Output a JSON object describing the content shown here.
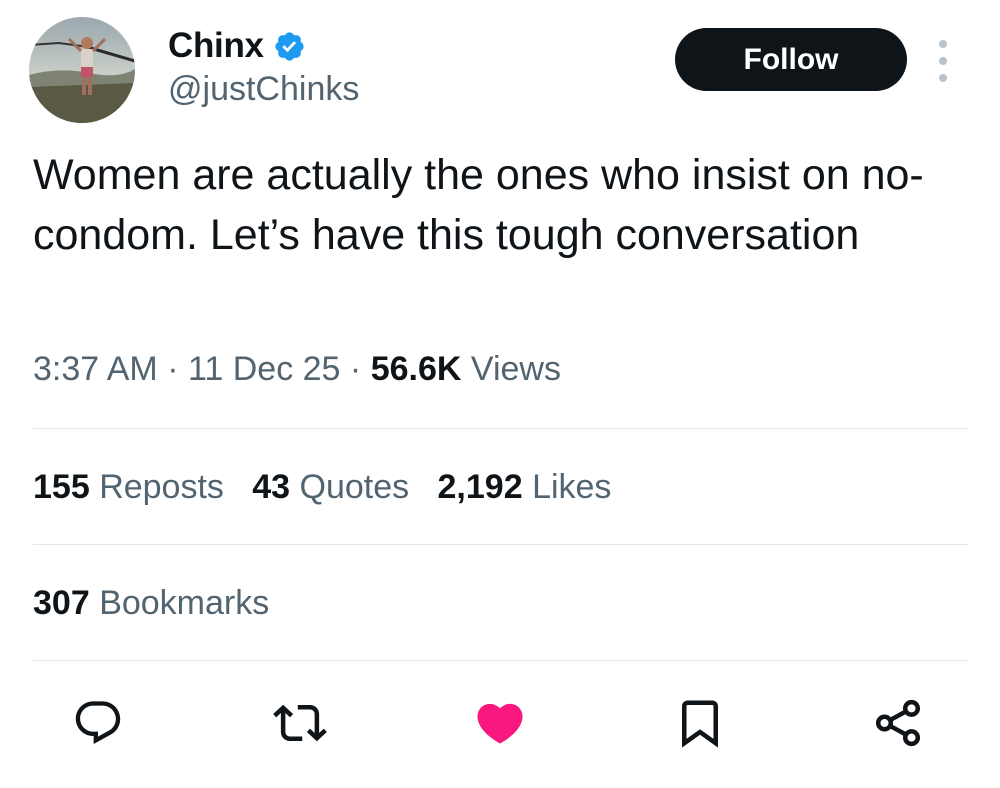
{
  "user": {
    "display_name": "Chinx",
    "handle": "@justChinks",
    "verified": true,
    "avatar_icon": "profile-photo",
    "verified_color": "#1d9bf0"
  },
  "header": {
    "follow_label": "Follow",
    "more_icon": "more-vertical-icon"
  },
  "tweet": {
    "text": "Women are actually the ones who insist on no-condom. Let’s have this tough conversation",
    "time": "3:37 AM",
    "separator": "·",
    "date": "11 Dec 25",
    "views_count": "56.6K",
    "views_label": "Views"
  },
  "stats": {
    "reposts": {
      "count": "155",
      "label": "Reposts"
    },
    "quotes": {
      "count": "43",
      "label": "Quotes"
    },
    "likes": {
      "count": "2,192",
      "label": "Likes"
    },
    "bookmarks": {
      "count": "307",
      "label": "Bookmarks"
    }
  },
  "actions": [
    {
      "icon": "reply-icon"
    },
    {
      "icon": "repost-icon"
    },
    {
      "icon": "like-icon",
      "active": true,
      "color": "#f91880"
    },
    {
      "icon": "bookmark-icon"
    },
    {
      "icon": "share-icon"
    }
  ],
  "colors": {
    "text": "#0f1419",
    "secondary": "#536471",
    "divider": "#e3e7ea",
    "follow_bg": "#0f1419"
  }
}
